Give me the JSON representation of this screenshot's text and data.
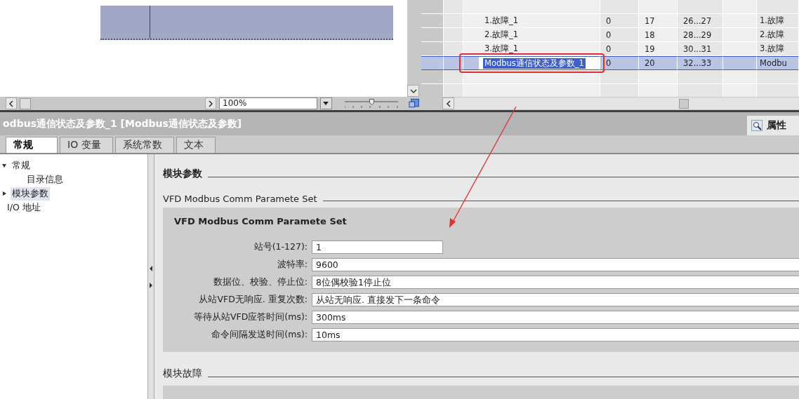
{
  "editor": {
    "zoom": "100%",
    "zoom_slider": {
      "level": 0.5
    }
  },
  "table": {
    "rows": [
      {
        "name": "1.故障_1",
        "column_2": "0",
        "column_3": "17",
        "column_4": "26...27",
        "column_6": "1.故障",
        "selected": false
      },
      {
        "name": "2.故障_1",
        "column_2": "0",
        "column_3": "18",
        "column_4": "28...29",
        "column_6": "2.故障",
        "selected": false
      },
      {
        "name": "3.故障_1",
        "column_2": "0",
        "column_3": "19",
        "column_4": "30...31",
        "column_6": "3.故障",
        "selected": false
      },
      {
        "name": "Modbus通信状态及参数_1",
        "column_2": "0",
        "column_3": "20",
        "column_4": "32...33",
        "column_6": "Modbu",
        "selected": true
      }
    ]
  },
  "inspector": {
    "title": "odbus通信状态及参数_1 [Modbus通信状态及参数]",
    "properties_tab": "属性",
    "tabs": [
      {
        "label": "常规",
        "selected": true
      },
      {
        "label": "IO 变量",
        "selected": false
      },
      {
        "label": "系统常数",
        "selected": false
      },
      {
        "label": "文本",
        "selected": false
      }
    ],
    "tree": [
      {
        "label": "常规",
        "expanded": true,
        "selected": false,
        "children": [
          {
            "label": "目录信息",
            "selected": false
          }
        ]
      },
      {
        "label": "模块参数",
        "expanded": false,
        "selected": true
      },
      {
        "label": "I/O 地址",
        "selected": false
      }
    ],
    "section_heading": "模块参数",
    "group_heading": "VFD Modbus Comm Paramete Set",
    "panel_title": "VFD Modbus Comm Paramete Set",
    "fields": [
      {
        "label": "站号(1-127):",
        "value": "1",
        "kind": "short"
      },
      {
        "label": "波特率:",
        "value": "9600",
        "kind": "long"
      },
      {
        "label": "数据位、校验、停止位:",
        "value": "8位偶校验1停止位",
        "kind": "long"
      },
      {
        "label": "从站VFD无响应. 重复次数:",
        "value": "从站无响应. 直接发下一条命令",
        "kind": "long"
      },
      {
        "label": "等待从站VFD应答时间(ms):",
        "value": "300ms",
        "kind": "long"
      },
      {
        "label": "命令间隔发送时间(ms):",
        "value": "10ms",
        "kind": "long"
      }
    ],
    "fault_heading": "模块故障"
  }
}
